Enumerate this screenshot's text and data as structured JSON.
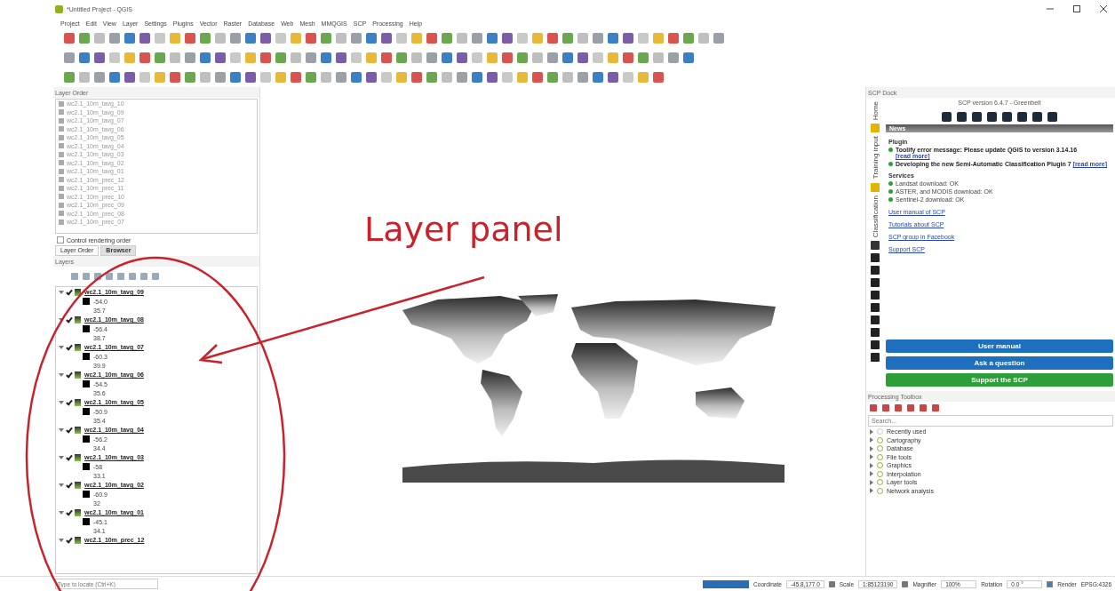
{
  "window": {
    "title": "*Untitled Project - QGIS"
  },
  "menu": [
    "Project",
    "Edit",
    "View",
    "Layer",
    "Settings",
    "Plugins",
    "Vector",
    "Raster",
    "Database",
    "Web",
    "Mesh",
    "MMQGIS",
    "SCP",
    "Processing",
    "Help"
  ],
  "layer_order_panel": {
    "title": "Layer Order",
    "items": [
      "wc2.1_10m_tavg_10",
      "wc2.1_10m_tavg_09",
      "wc2.1_10m_tavg_07",
      "wc2.1_10m_tavg_06",
      "wc2.1_10m_tavg_05",
      "wc2.1_10m_tavg_04",
      "wc2.1_10m_tavg_03",
      "wc2.1_10m_tavg_02",
      "wc2.1_10m_tavg_01",
      "wc2.1_10m_prec_12",
      "wc2.1_10m_prec_11",
      "wc2.1_10m_prec_10",
      "wc2.1_10m_prec_09",
      "wc2.1_10m_prec_08",
      "wc2.1_10m_prec_07"
    ],
    "control_rendering_order": {
      "label": "Control rendering order",
      "checked": false
    },
    "tabs": [
      {
        "label": "Layer Order",
        "selected": false
      },
      {
        "label": "Browser",
        "selected": true
      }
    ]
  },
  "layers_panel": {
    "title": "Layers",
    "layers": [
      {
        "name": "wc2.1_10m_tavg_09",
        "checked": true,
        "min": "-54.0",
        "max": "35.7"
      },
      {
        "name": "wc2.1_10m_tavg_08",
        "checked": true,
        "min": "-56.4",
        "max": "38.7"
      },
      {
        "name": "wc2.1_10m_tavg_07",
        "checked": true,
        "min": "-60.3",
        "max": "39.9"
      },
      {
        "name": "wc2.1_10m_tavg_06",
        "checked": true,
        "min": "-54.5",
        "max": "35.6"
      },
      {
        "name": "wc2.1_10m_tavg_05",
        "checked": true,
        "min": "-50.9",
        "max": "35.4"
      },
      {
        "name": "wc2.1_10m_tavg_04",
        "checked": true,
        "min": "-56.2",
        "max": "34.4"
      },
      {
        "name": "wc2.1_10m_tavg_03",
        "checked": true,
        "min": "-58",
        "max": "33.1"
      },
      {
        "name": "wc2.1_10m_tavg_02",
        "checked": true,
        "min": "-60.9",
        "max": "32"
      },
      {
        "name": "wc2.1_10m_tavg_01",
        "checked": true,
        "min": "-45.1",
        "max": "34.1"
      },
      {
        "name": "wc2.1_10m_prec_12",
        "checked": true
      }
    ]
  },
  "annotation": {
    "text": "Layer panel"
  },
  "scp_dock": {
    "title": "SCP Dock",
    "version": "SCP version 6.4.7 - Greenbelt",
    "side_tabs": [
      "Home",
      "Training input",
      "Classification"
    ],
    "news_header": "News",
    "plugin_heading": "Plugin",
    "plugin_news": [
      {
        "text": "Toolify error message: Please update QGIS to version 3.14.16",
        "link": "[read more]"
      },
      {
        "text": "Developing the new Semi-Automatic Classification Plugin 7",
        "link": "[read more]"
      }
    ],
    "services_heading": "Services",
    "services": [
      "Landsat download: OK",
      "ASTER, and MODIS download: OK",
      "Sentinel-2 download: OK"
    ],
    "links": [
      "User manual of SCP",
      "Tutorials about SCP",
      "SCP group in Facebook",
      "Support SCP"
    ],
    "buttons": [
      {
        "label": "User manual",
        "kind": "blue"
      },
      {
        "label": "Ask a question",
        "kind": "blue"
      },
      {
        "label": "Support the SCP",
        "kind": "green"
      }
    ]
  },
  "processing_toolbox": {
    "title": "Processing Toolbox",
    "search": {
      "placeholder": "Search..."
    },
    "items": [
      {
        "label": "Recently used",
        "kind": "recent"
      },
      {
        "label": "Cartography",
        "kind": "group"
      },
      {
        "label": "Database",
        "kind": "group"
      },
      {
        "label": "File tools",
        "kind": "group"
      },
      {
        "label": "Graphics",
        "kind": "group"
      },
      {
        "label": "Interpolation",
        "kind": "group"
      },
      {
        "label": "Layer tools",
        "kind": "group"
      },
      {
        "label": "Network analysis",
        "kind": "group"
      }
    ]
  },
  "status_bar": {
    "progress": {
      "level": 1
    },
    "locator_placeholder": "Type to locate (Ctrl+K)",
    "coordinate_label": "Coordinate",
    "coordinate": "-45.8,177.0",
    "scale_label": "Scale",
    "scale": "1:85123190",
    "magnifier_label": "Magnifier",
    "magnifier": "100%",
    "rotation_label": "Rotation",
    "rotation": "0.0 °",
    "render": {
      "label": "Render",
      "checked": true
    },
    "crs": "EPSG:4326"
  }
}
